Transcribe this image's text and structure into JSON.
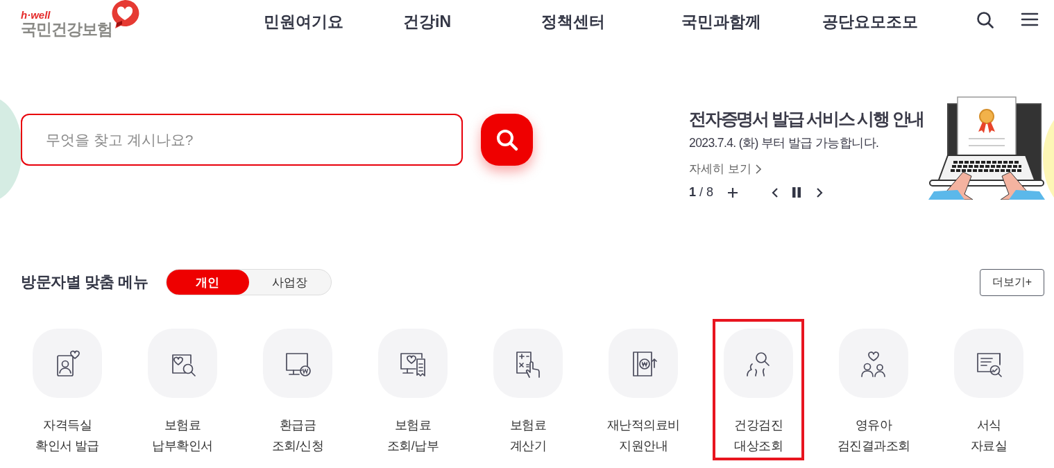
{
  "header": {
    "logo": {
      "tagline": "h·well",
      "name": "국민건강보험"
    },
    "nav": [
      {
        "label": "민원여기요"
      },
      {
        "label": "건강iN"
      },
      {
        "label": "정책센터"
      },
      {
        "label": "국민과함께"
      },
      {
        "label": "공단요모조모"
      }
    ]
  },
  "search": {
    "placeholder": "무엇을 찾고 계시나요?"
  },
  "banner": {
    "title": "전자증명서 발급 서비스 시행 안내",
    "subtitle": "2023.7.4. (화) 부터 발급 가능합니다.",
    "link": "자세히 보기",
    "pager": {
      "current": "1",
      "total": "/ 8"
    }
  },
  "menu": {
    "title": "방문자별 맞춤 메뉴",
    "tabs": [
      {
        "label": "개인",
        "selected": true
      },
      {
        "label": "사업장",
        "selected": false
      }
    ],
    "more": "더보기+",
    "items": [
      {
        "label": "자격득실\n확인서 발급",
        "highlighted": false
      },
      {
        "label": "보험료\n납부확인서",
        "highlighted": false
      },
      {
        "label": "환급금\n조회/신청",
        "highlighted": false
      },
      {
        "label": "보험료\n조회/납부",
        "highlighted": false
      },
      {
        "label": "보험료\n계산기",
        "highlighted": false
      },
      {
        "label": "재난적의료비\n지원안내",
        "highlighted": false
      },
      {
        "label": "건강검진\n대상조회",
        "highlighted": true
      },
      {
        "label": "영유아\n검진결과조회",
        "highlighted": false
      },
      {
        "label": "서식\n자료실",
        "highlighted": false
      }
    ]
  }
}
